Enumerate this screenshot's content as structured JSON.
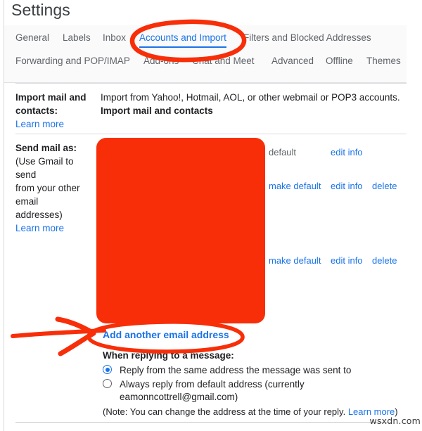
{
  "page": {
    "title": "Settings",
    "watermark": "wsxdn.com"
  },
  "tabs": {
    "row1": [
      {
        "label": "General",
        "active": false
      },
      {
        "label": "Labels",
        "active": false
      },
      {
        "label": "Inbox",
        "active": false
      },
      {
        "label": "Accounts and Import",
        "active": true
      },
      {
        "label": "Filters and Blocked Addresses",
        "active": false
      }
    ],
    "row2": [
      {
        "label": "Forwarding and POP/IMAP",
        "active": false
      },
      {
        "label": "Add-ons",
        "active": false
      },
      {
        "label": "Chat and Meet",
        "active": false
      },
      {
        "label": "Advanced",
        "active": false
      },
      {
        "label": "Offline",
        "active": false
      },
      {
        "label": "Themes",
        "active": false
      }
    ]
  },
  "import_section": {
    "label_line1": "Import mail and",
    "label_line2": "contacts:",
    "learn_more": "Learn more",
    "description": "Import from Yahoo!, Hotmail, AOL, or other webmail or POP3 accounts.",
    "action_link": "Import mail and contacts"
  },
  "send_mail_as": {
    "label": "Send mail as:",
    "note_line1": "(Use Gmail to send",
    "note_line2": "from your other email",
    "note_line3": "addresses)",
    "learn_more": "Learn more",
    "rows": [
      {
        "status": "default",
        "actions": [
          "edit info"
        ]
      },
      {
        "status": "",
        "actions": [
          "make default",
          "edit info",
          "delete"
        ]
      },
      {
        "status": "",
        "actions": [
          "make default",
          "edit info",
          "delete"
        ]
      }
    ],
    "add_another": "Add another email address"
  },
  "reply_settings": {
    "heading": "When replying to a message:",
    "option_same": "Reply from the same address the message was sent to",
    "option_default_line1": "Always reply from default address (currently",
    "option_default_line2": "eamonncottrell@gmail.com)",
    "selected": "same",
    "note_prefix": "(Note: You can change the address at the time of your reply. ",
    "note_link": "Learn more",
    "note_suffix": ")"
  },
  "annotations": {
    "circle_tab": "ellipse-around-accounts-and-import-tab",
    "circle_add_link": "ellipse-around-add-another-email-address",
    "arrow": "arrow-pointing-right-to-add-another-email-address",
    "redaction": "red-block-hiding-email-addresses",
    "color": "#f82e09"
  }
}
